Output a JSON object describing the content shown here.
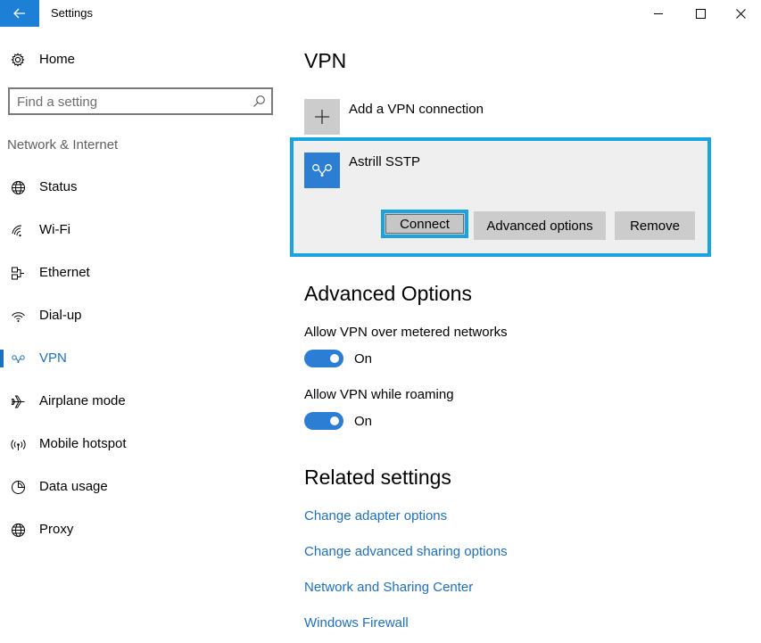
{
  "window": {
    "title": "Settings",
    "minimize_glyph": "—",
    "close_glyph": "✕"
  },
  "sidebar": {
    "home_label": "Home",
    "search_placeholder": "Find a setting",
    "section_label": "Network & Internet",
    "items": [
      {
        "label": "Status",
        "icon": "globe-status-icon"
      },
      {
        "label": "Wi-Fi",
        "icon": "wifi-icon"
      },
      {
        "label": "Ethernet",
        "icon": "ethernet-icon"
      },
      {
        "label": "Dial-up",
        "icon": "dialup-icon"
      },
      {
        "label": "VPN",
        "icon": "vpn-icon",
        "active": true
      },
      {
        "label": "Airplane mode",
        "icon": "airplane-icon"
      },
      {
        "label": "Mobile hotspot",
        "icon": "hotspot-icon"
      },
      {
        "label": "Data usage",
        "icon": "data-usage-icon"
      },
      {
        "label": "Proxy",
        "icon": "globe-proxy-icon"
      }
    ]
  },
  "main": {
    "title": "VPN",
    "add_vpn_label": "Add a VPN connection",
    "vpn_connection": {
      "name": "Astrill SSTP",
      "connect_label": "Connect",
      "advanced_label": "Advanced options",
      "remove_label": "Remove"
    },
    "advanced_title": "Advanced Options",
    "metered": {
      "label": "Allow VPN over metered networks",
      "state": "On"
    },
    "roaming": {
      "label": "Allow VPN while roaming",
      "state": "On"
    },
    "related_title": "Related settings",
    "links": [
      "Change adapter options",
      "Change advanced sharing options",
      "Network and Sharing Center",
      "Windows Firewall"
    ]
  },
  "colors": {
    "accent": "#1d6fbf",
    "highlight_border": "#19a3e0",
    "tile_blue": "#2b7ed3"
  }
}
